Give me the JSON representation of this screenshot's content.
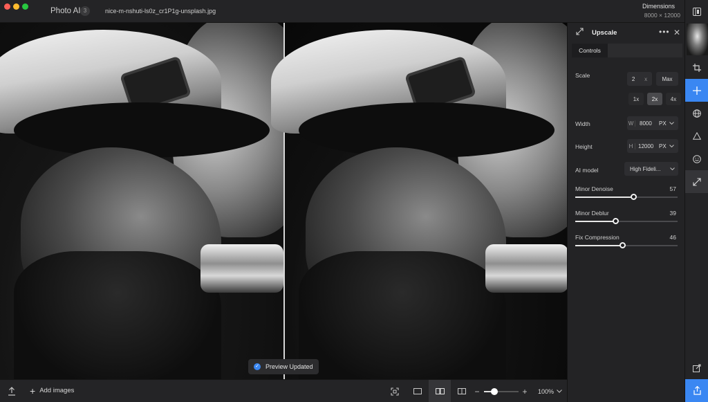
{
  "titlebar": {
    "app_name": "Photo AI",
    "image_count": "3",
    "file_name": "nice-m-nshuti-ls0z_cr1P1g-unsplash.jpg",
    "dimensions_label": "Dimensions",
    "dimensions_value": "8000 × 12000"
  },
  "toast": {
    "text": "Preview Updated"
  },
  "bottombar": {
    "add_images": "Add images",
    "zoom": "100%",
    "zoom_level": 0.3
  },
  "panel": {
    "title": "Upscale",
    "tab_controls": "Controls",
    "scale": {
      "label": "Scale",
      "value": "2",
      "unit": "x",
      "max_label": "Max",
      "options": [
        "1x",
        "2x",
        "4x"
      ],
      "selected": "2x"
    },
    "width": {
      "label": "Width",
      "prefix": "W",
      "value": "8000",
      "unit": "PX"
    },
    "height": {
      "label": "Height",
      "prefix": "H",
      "value": "12000",
      "unit": "PX"
    },
    "ai_model": {
      "label": "AI model",
      "value": "High Fideli..."
    },
    "sliders": [
      {
        "label": "Minor Denoise",
        "value": "57",
        "level": 0.57
      },
      {
        "label": "Minor Deblur",
        "value": "39",
        "level": 0.39
      },
      {
        "label": "Fix Compression",
        "value": "46",
        "level": 0.46
      }
    ]
  },
  "colors": {
    "accent": "#3a87f2",
    "panel_bg": "#232325",
    "toolbar_bg": "#242426"
  }
}
